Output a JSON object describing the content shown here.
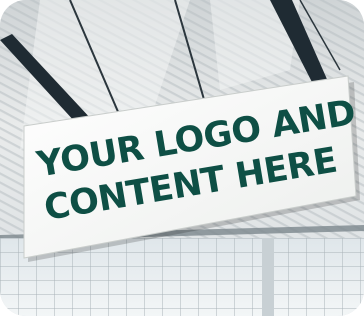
{
  "billboard": {
    "line1": "YOUR LOGO AND",
    "line2": "CONTENT HERE",
    "text_color": "#0e4f45",
    "panel_color": "#f7f8f6"
  },
  "scene": {
    "description_colors": {
      "ceiling_light": "#e6e8e8",
      "ceiling_shadow": "#b9bfc3",
      "beam": "#1e2a32",
      "window": "#eef2f4",
      "window_frame": "#9fa8ad"
    }
  }
}
